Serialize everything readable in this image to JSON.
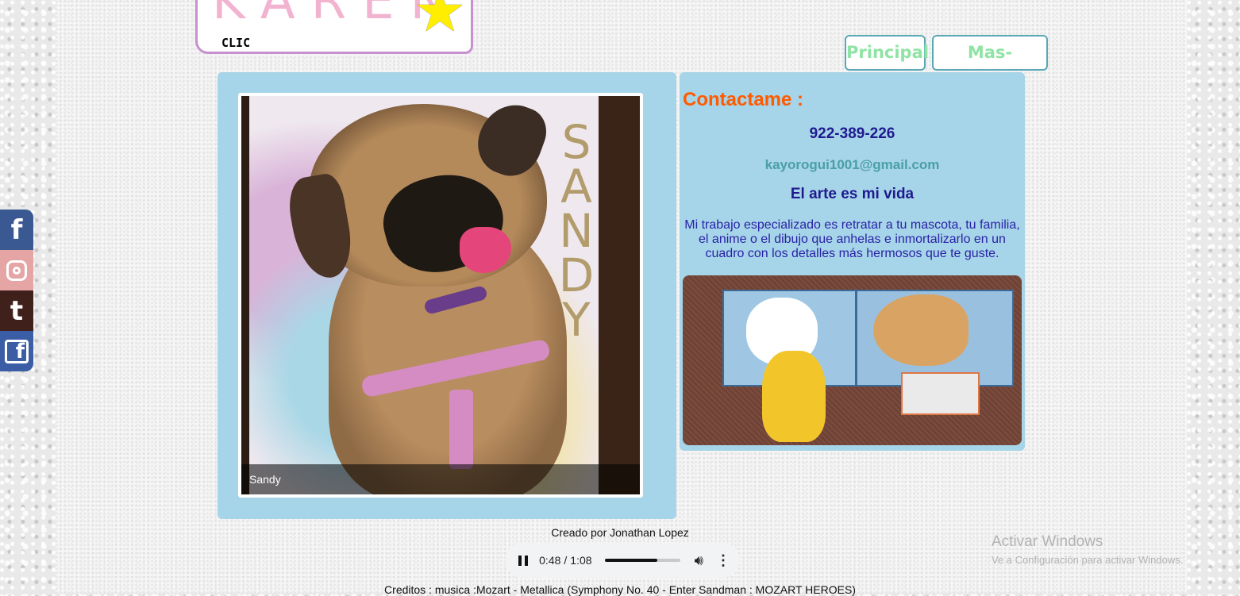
{
  "logo": {
    "name": "KAREN",
    "sub": "CLIC"
  },
  "nav": {
    "items": [
      {
        "label": "Principal"
      },
      {
        "label": "Mas-dibujos"
      }
    ]
  },
  "gallery": {
    "caption": "Sandy",
    "painting_text": "SANDY"
  },
  "contact": {
    "title": "Contactame :",
    "phone": "922-389-226",
    "email": "kayorogui1001@gmail.com",
    "motto": "El arte es mi vida",
    "description": "Mi trabajo especializado es retratar a tu mascota, tu familia, el anime o el dibujo que anhelas e inmortalizarlo en un cuadro con los detalles más hermosos que te guste."
  },
  "social": {
    "items": [
      {
        "name": "facebook",
        "glyph": "f",
        "color": "#3a5891"
      },
      {
        "name": "instagram",
        "glyph": "",
        "color": "#e6a5a5"
      },
      {
        "name": "tumblr",
        "glyph": "t",
        "color": "#40201a"
      },
      {
        "name": "facebook-square",
        "glyph": "f",
        "color": "#3b5da5"
      }
    ]
  },
  "footer": {
    "credit": "Creado por Jonathan Lopez",
    "music_credit": "Creditos : musica :Mozart - Metallica (Symphony No. 40 - Enter Sandman : MOZART HEROES)"
  },
  "audio": {
    "current": "0:48",
    "duration": "1:08",
    "progress": 0.7
  },
  "watermark": {
    "title": "Activar Windows",
    "subtitle": "Ve a Configuración para activar Windows."
  },
  "colors": {
    "panel": "#a6d4e8",
    "accent": "#ff5a00",
    "text_dark_blue": "#1f1a8f",
    "nav_text": "#8fe3a4",
    "nav_border": "#5aa7b5"
  }
}
